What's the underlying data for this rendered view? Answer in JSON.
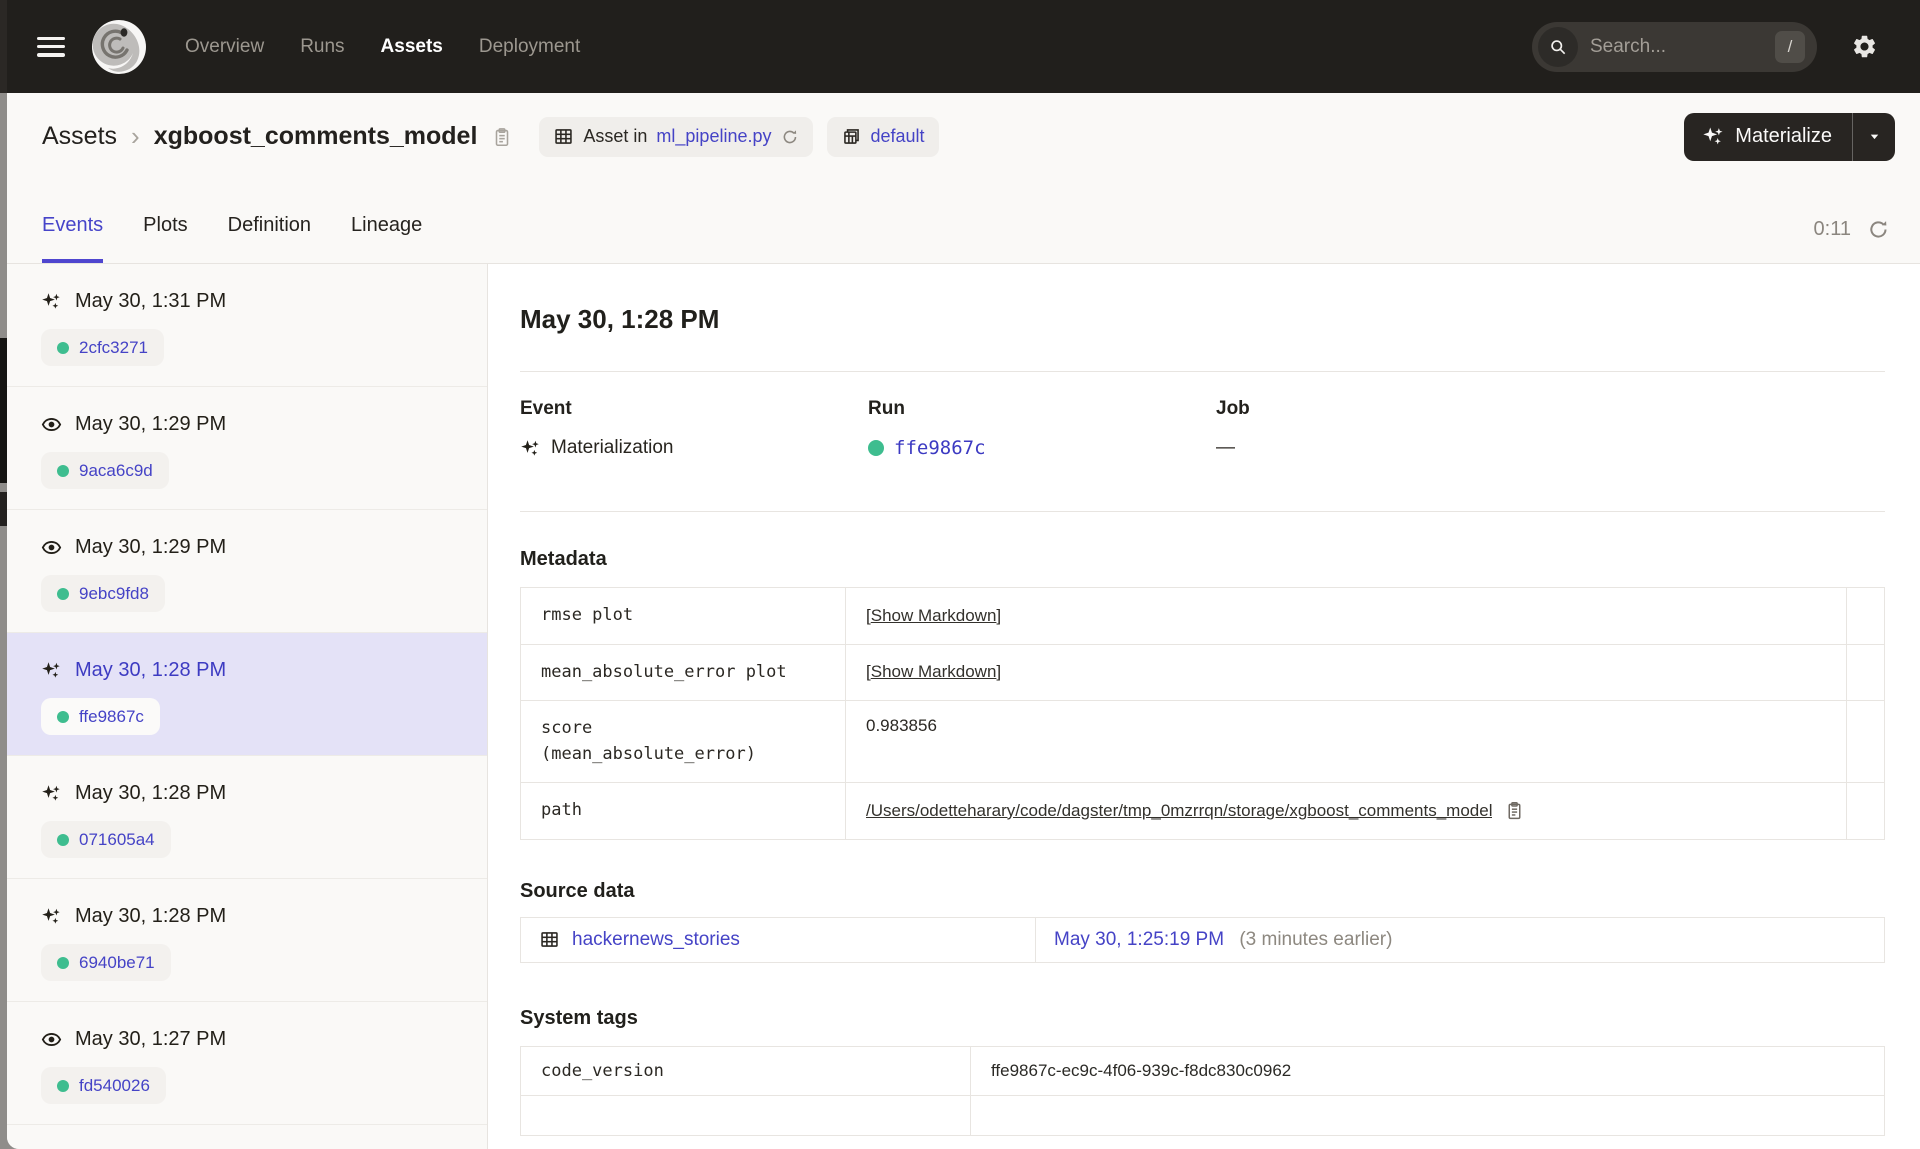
{
  "colors": {
    "accent_indigo": "#4543C6",
    "active_tab": "#4644C9",
    "success_green": "#3EBD8F",
    "navbar_bg": "#211F1C",
    "selected_row_bg": "#E4E2F7",
    "page_bg": "#FAF9F7"
  },
  "nav": {
    "items": [
      {
        "label": "Overview"
      },
      {
        "label": "Runs"
      },
      {
        "label": "Assets"
      },
      {
        "label": "Deployment"
      }
    ],
    "active": "Assets",
    "search_placeholder": "Search...",
    "search_shortcut": "/"
  },
  "breadcrumb": {
    "root": "Assets",
    "separator": "›",
    "current": "xgboost_comments_model"
  },
  "chips": {
    "asset_in_prefix": "Asset in",
    "asset_in_link": "ml_pipeline.py",
    "repo": "default"
  },
  "actions": {
    "materialize": "Materialize"
  },
  "tabs": {
    "items": [
      {
        "label": "Events"
      },
      {
        "label": "Plots"
      },
      {
        "label": "Definition"
      },
      {
        "label": "Lineage"
      }
    ],
    "active": "Events",
    "refresh_countdown": "0:11"
  },
  "sidebar": {
    "events": [
      {
        "type": "materialization",
        "time": "May 30, 1:31 PM",
        "run_id": "2cfc3271",
        "selected": false
      },
      {
        "type": "observation",
        "time": "May 30, 1:29 PM",
        "run_id": "9aca6c9d",
        "selected": false
      },
      {
        "type": "observation",
        "time": "May 30, 1:29 PM",
        "run_id": "9ebc9fd8",
        "selected": false
      },
      {
        "type": "materialization",
        "time": "May 30, 1:28 PM",
        "run_id": "ffe9867c",
        "selected": true
      },
      {
        "type": "materialization",
        "time": "May 30, 1:28 PM",
        "run_id": "071605a4",
        "selected": false
      },
      {
        "type": "materialization",
        "time": "May 30, 1:28 PM",
        "run_id": "6940be71",
        "selected": false
      },
      {
        "type": "observation",
        "time": "May 30, 1:27 PM",
        "run_id": "fd540026",
        "selected": false
      }
    ]
  },
  "detail": {
    "title": "May 30, 1:28 PM",
    "event_label": "Event",
    "event_value": "Materialization",
    "run_label": "Run",
    "run_value": "ffe9867c",
    "job_label": "Job",
    "job_value": "—",
    "metadata": {
      "heading": "Metadata",
      "brackets": {
        "open": "[",
        "close": "]"
      },
      "rows": [
        {
          "key": "rmse plot",
          "link": "Show Markdown"
        },
        {
          "key": "mean_absolute_error plot",
          "link": "Show Markdown"
        },
        {
          "key": "score\n(mean_absolute_error)",
          "value": "0.983856"
        },
        {
          "key": "path",
          "value": "/Users/odetteharary/code/dagster/tmp_0mzrrqn/storage/xgboost_comments_model"
        }
      ]
    },
    "source_data": {
      "heading": "Source data",
      "asset": "hackernews_stories",
      "timestamp": "May 30, 1:25:19 PM",
      "note": "(3 minutes earlier)"
    },
    "system_tags": {
      "heading": "System tags",
      "rows": [
        {
          "key": "code_version",
          "value": "ffe9867c-ec9c-4f06-939c-f8dc830c0962"
        }
      ]
    }
  }
}
